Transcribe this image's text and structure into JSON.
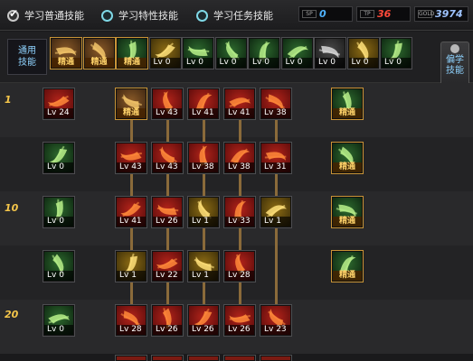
{
  "tabs": [
    {
      "label": "学习普通技能",
      "checked": true
    },
    {
      "label": "学习特性技能",
      "checked": false
    },
    {
      "label": "学习任务技能",
      "checked": false
    }
  ],
  "resources": [
    {
      "icon": "SP",
      "value": "0",
      "color": "#4fb3ff"
    },
    {
      "icon": "TP",
      "value": "36",
      "color": "#ff4a3a"
    },
    {
      "icon": "GOLD",
      "value": "3974",
      "color": "#9ec3ff"
    }
  ],
  "common": {
    "label_line1": "通用",
    "label_line2": "技能",
    "skills": [
      {
        "level": "精通",
        "mastered": true,
        "icon": "sitting-figure-icon",
        "tone": "brown"
      },
      {
        "level": "精通",
        "mastered": true,
        "icon": "kneeling-figure-icon",
        "tone": "brown"
      },
      {
        "level": "精通",
        "mastered": true,
        "icon": "running-figure-icon",
        "tone": "green"
      },
      {
        "level": "Lv 0",
        "mastered": false,
        "icon": "wings-icon",
        "tone": "gold"
      },
      {
        "level": "Lv 0",
        "mastered": false,
        "icon": "crosshair-icon",
        "tone": "green"
      },
      {
        "level": "Lv 0",
        "mastered": false,
        "icon": "crosshair-icon",
        "tone": "green"
      },
      {
        "level": "Lv 0",
        "mastered": false,
        "icon": "figure-icon",
        "tone": "green"
      },
      {
        "level": "Lv 0",
        "mastered": false,
        "icon": "crouching-figure-icon",
        "tone": "green"
      },
      {
        "level": "Lv 0",
        "mastered": false,
        "icon": "target-icon",
        "tone": "dark"
      },
      {
        "level": "Lv 0",
        "mastered": false,
        "icon": "warrior-icon",
        "tone": "gold"
      },
      {
        "level": "Lv 0",
        "mastered": false,
        "icon": "fighter-icon",
        "tone": "green"
      }
    ]
  },
  "side_button": {
    "line1": "偏学",
    "line2": "技能"
  },
  "tree": {
    "level_marks": [
      "1",
      "10",
      "20"
    ],
    "rows": [
      {
        "skills": [
          {
            "col": 0,
            "level": "Lv 24",
            "mastered": false,
            "icon": "dagger-icon",
            "tone": "red"
          },
          {
            "col": 1,
            "level": "精通",
            "mastered": true,
            "icon": "slash-icon",
            "tone": "brown"
          },
          {
            "col": 2,
            "level": "Lv 43",
            "mastered": false,
            "icon": "flame-icon",
            "tone": "red"
          },
          {
            "col": 3,
            "level": "Lv 41",
            "mastered": false,
            "icon": "blade-icon",
            "tone": "red"
          },
          {
            "col": 4,
            "level": "Lv 41",
            "mastered": false,
            "icon": "burst-icon",
            "tone": "red"
          },
          {
            "col": 5,
            "level": "Lv 38",
            "mastered": false,
            "icon": "whirl-icon",
            "tone": "red"
          },
          {
            "col": 6,
            "level": "精通",
            "mastered": true,
            "icon": "book-icon",
            "tone": "green"
          }
        ]
      },
      {
        "skills": [
          {
            "col": 0,
            "level": "Lv 0",
            "mastered": false,
            "icon": "sword-icon",
            "tone": "green"
          },
          {
            "col": 1,
            "level": "Lv 43",
            "mastered": false,
            "icon": "burst-icon",
            "tone": "red"
          },
          {
            "col": 2,
            "level": "Lv 43",
            "mastered": false,
            "icon": "flame-icon",
            "tone": "red"
          },
          {
            "col": 3,
            "level": "Lv 38",
            "mastered": false,
            "icon": "claw-icon",
            "tone": "red"
          },
          {
            "col": 4,
            "level": "Lv 38",
            "mastered": false,
            "icon": "burst-icon",
            "tone": "red"
          },
          {
            "col": 5,
            "level": "Lv 31",
            "mastered": false,
            "icon": "flame-icon",
            "tone": "red"
          },
          {
            "col": 6,
            "level": "精通",
            "mastered": true,
            "icon": "mesh-icon",
            "tone": "green"
          }
        ]
      },
      {
        "skills": [
          {
            "col": 0,
            "level": "Lv 0",
            "mastered": false,
            "icon": "greatsword-icon",
            "tone": "green"
          },
          {
            "col": 1,
            "level": "Lv 41",
            "mastered": false,
            "icon": "orb-icon",
            "tone": "red"
          },
          {
            "col": 2,
            "level": "Lv 26",
            "mastered": false,
            "icon": "claw-icon",
            "tone": "red"
          },
          {
            "col": 3,
            "level": "Lv 1",
            "mastered": false,
            "icon": "crest-icon",
            "tone": "gold"
          },
          {
            "col": 4,
            "level": "Lv 33",
            "mastered": false,
            "icon": "flame-icon",
            "tone": "red"
          },
          {
            "col": 5,
            "level": "Lv 1",
            "mastered": false,
            "icon": "slash-icon",
            "tone": "gold"
          },
          {
            "col": 6,
            "level": "精通",
            "mastered": true,
            "icon": "blocks-icon",
            "tone": "green"
          }
        ]
      },
      {
        "skills": [
          {
            "col": 0,
            "level": "Lv 0",
            "mastered": false,
            "icon": "spark-icon",
            "tone": "green"
          },
          {
            "col": 1,
            "level": "Lv 1",
            "mastered": false,
            "icon": "dash-icon",
            "tone": "gold"
          },
          {
            "col": 2,
            "level": "Lv 22",
            "mastered": false,
            "icon": "flame-icon",
            "tone": "red"
          },
          {
            "col": 3,
            "level": "Lv 1",
            "mastered": false,
            "icon": "arrow-icon",
            "tone": "gold"
          },
          {
            "col": 4,
            "level": "Lv 28",
            "mastered": false,
            "icon": "whirl-icon",
            "tone": "red"
          },
          {
            "col": 6,
            "level": "精通",
            "mastered": true,
            "icon": "scroll-icon",
            "tone": "green"
          }
        ]
      },
      {
        "skills": [
          {
            "col": 0,
            "level": "Lv 0",
            "mastered": false,
            "icon": "branch-icon",
            "tone": "green"
          },
          {
            "col": 1,
            "level": "Lv 28",
            "mastered": false,
            "icon": "claw-icon",
            "tone": "red"
          },
          {
            "col": 2,
            "level": "Lv 26",
            "mastered": false,
            "icon": "vortex-icon",
            "tone": "red"
          },
          {
            "col": 3,
            "level": "Lv 26",
            "mastered": false,
            "icon": "whirl-icon",
            "tone": "red"
          },
          {
            "col": 4,
            "level": "Lv 26",
            "mastered": false,
            "icon": "burst-icon",
            "tone": "red"
          },
          {
            "col": 5,
            "level": "Lv 23",
            "mastered": false,
            "icon": "whirl-icon",
            "tone": "red"
          }
        ]
      }
    ]
  }
}
